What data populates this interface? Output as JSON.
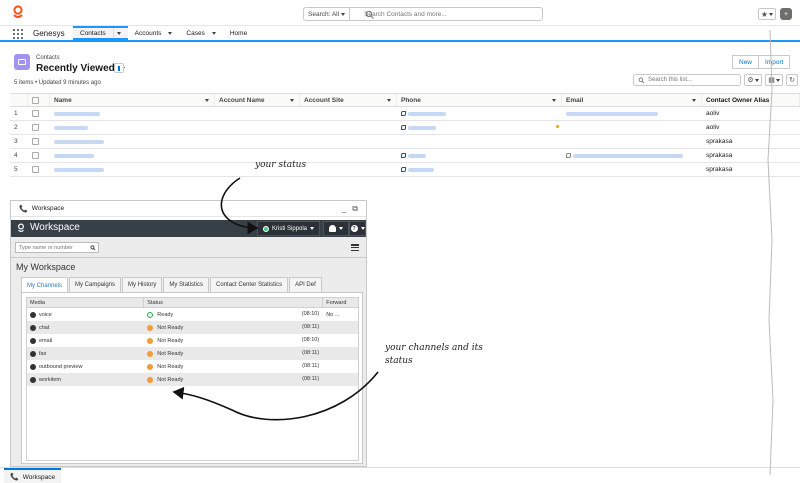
{
  "app": {
    "name": "Genesys",
    "search_scope": "Search: All",
    "search_placeholder": "Search Contacts and more...",
    "nav_tabs": [
      {
        "label": "Contacts",
        "active": true
      },
      {
        "label": "Accounts"
      },
      {
        "label": "Cases"
      },
      {
        "label": "Home"
      }
    ]
  },
  "list": {
    "object_label": "Contacts",
    "title": "Recently Viewed",
    "meta": "5 items • Updated 9 minutes ago",
    "buttons": {
      "new": "New",
      "import": "Import"
    },
    "search_placeholder": "Search this list...",
    "columns": [
      "Name",
      "Account Name",
      "Account Site",
      "Phone",
      "Email",
      "Contact Owner Alias"
    ],
    "rows": [
      {
        "num": "1",
        "owner": "aoliv",
        "phone": true,
        "email": true
      },
      {
        "num": "2",
        "owner": "aoliv",
        "phone": true,
        "email": false
      },
      {
        "num": "3",
        "owner": "sprakasa",
        "phone": false,
        "email": false
      },
      {
        "num": "4",
        "owner": "sprakasa",
        "phone": true,
        "email": true
      },
      {
        "num": "5",
        "owner": "sprakasa",
        "phone": true,
        "email": false
      }
    ]
  },
  "workspace": {
    "popout_title": "Workspace",
    "bar_title": "Workspace",
    "agent_name": "Kristi Sippola",
    "search_placeholder": "Type name or number",
    "heading": "My Workspace",
    "tabs": [
      "My Channels",
      "My Campaigns",
      "My History",
      "My Statistics",
      "Contact Center Statistics",
      "API Def"
    ],
    "columns": [
      "Media",
      "Status",
      "Forward"
    ],
    "channels": [
      {
        "media": "voice",
        "status": "Ready",
        "duration": "(08:10)",
        "forward": "No ...",
        "ready": true
      },
      {
        "media": "chat",
        "status": "Not Ready",
        "duration": "(08:11)",
        "forward": "",
        "ready": false
      },
      {
        "media": "email",
        "status": "Not Ready",
        "duration": "(08:10)",
        "forward": "",
        "ready": false
      },
      {
        "media": "fax",
        "status": "Not Ready",
        "duration": "(08:11)",
        "forward": "",
        "ready": false
      },
      {
        "media": "outbound preview",
        "status": "Not Ready",
        "duration": "(08:11)",
        "forward": "",
        "ready": false
      },
      {
        "media": "workitem",
        "status": "Not Ready",
        "duration": "(08:11)",
        "forward": "",
        "ready": false
      }
    ]
  },
  "utility_bar": {
    "label": "Workspace"
  },
  "annotations": {
    "status_note": "your status",
    "channels_note": "your channels and its status"
  }
}
